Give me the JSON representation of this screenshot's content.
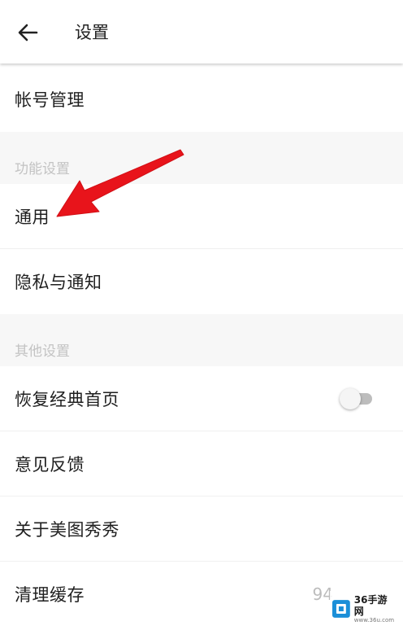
{
  "header": {
    "title": "设置",
    "back_icon": "arrow-left-icon"
  },
  "rows": {
    "account": "帐号管理",
    "general": "通用",
    "privacy": "隐私与通知",
    "classic_home": "恢复经典首页",
    "feedback": "意见反馈",
    "about": "关于美图秀秀",
    "clear_cache": "清理缓存"
  },
  "sections": {
    "features": "功能设置",
    "other": "其他设置"
  },
  "classic_home_toggle": {
    "on": false
  },
  "cache_size": "94",
  "watermark": {
    "name": "36手游网",
    "url": "www.36u.com"
  },
  "colors": {
    "annotation_arrow": "#e8141b",
    "section_bg": "#f7f7f7",
    "section_text": "#c3c3c3"
  }
}
